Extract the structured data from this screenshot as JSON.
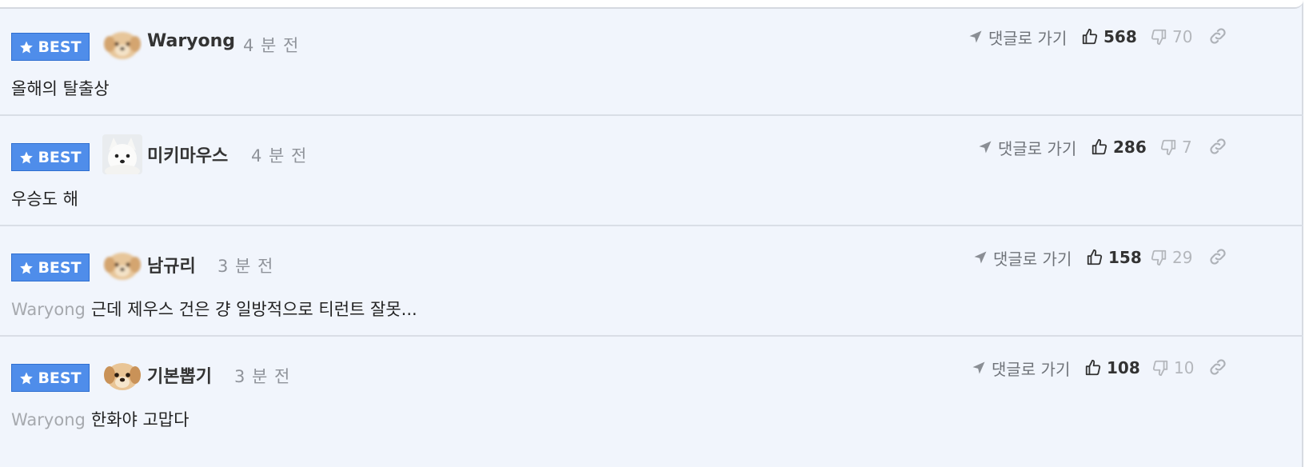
{
  "comments": [
    {
      "badge": "BEST",
      "username": "Waryong",
      "time": "4 분 전",
      "mention": "",
      "text": "올해의 탈출상",
      "goto_label": "댓글로 가기",
      "likes": "568",
      "dislikes": "70",
      "avatar": "puppy-blurred"
    },
    {
      "badge": "BEST",
      "username": "미키마우스",
      "time": "4 분 전",
      "mention": "",
      "text": "우승도 해",
      "goto_label": "댓글로 가기",
      "likes": "286",
      "dislikes": "7",
      "avatar": "white-dog"
    },
    {
      "badge": "BEST",
      "username": "남규리",
      "time": "3 분 전",
      "mention": "Waryong",
      "text": "근데 제우스 건은 걍 일방적으로 티런트 잘못...",
      "goto_label": "댓글로 가기",
      "likes": "158",
      "dislikes": "29",
      "avatar": "puppy-blurred"
    },
    {
      "badge": "BEST",
      "username": "기본뽑기",
      "time": "3 분 전",
      "mention": "Waryong",
      "text": "한화야 고맙다",
      "goto_label": "댓글로 가기",
      "likes": "108",
      "dislikes": "10",
      "avatar": "puppy"
    }
  ],
  "colors": {
    "panel_bg": "#f1f5fc",
    "badge_bg": "#4f8dea",
    "divider": "#d9dee6",
    "muted_text": "#8f939a"
  },
  "icons": {
    "badge": "star-icon",
    "goto": "arrow-pointer-icon",
    "like": "thumbs-up-icon",
    "dislike": "thumbs-down-icon",
    "link": "link-icon"
  }
}
